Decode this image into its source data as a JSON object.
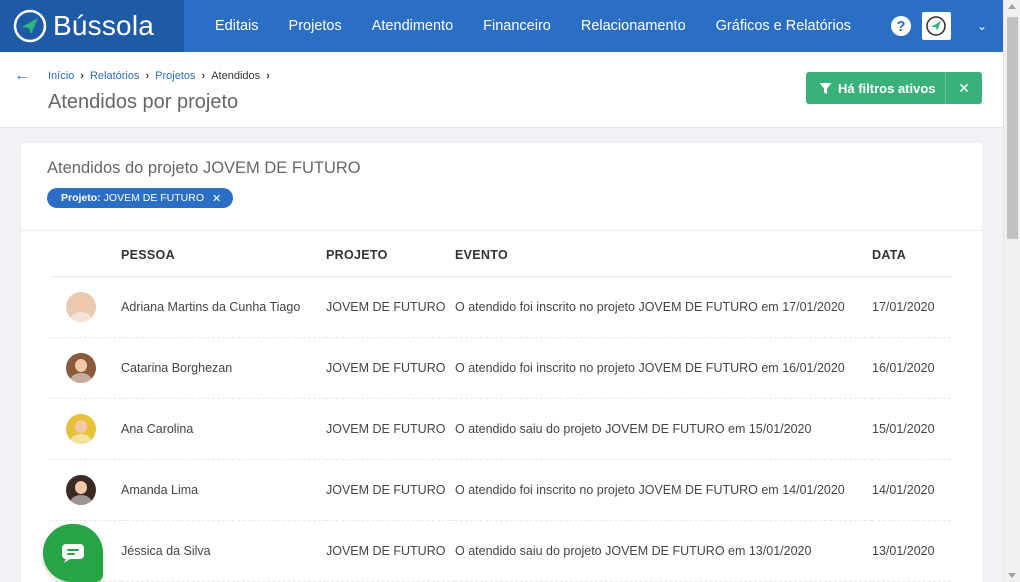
{
  "app": {
    "name": "Bússola",
    "brand_color": "#2b6fc4"
  },
  "nav": {
    "items": [
      {
        "label": "Editais"
      },
      {
        "label": "Projetos"
      },
      {
        "label": "Atendimento"
      },
      {
        "label": "Financeiro"
      },
      {
        "label": "Relacionamento"
      },
      {
        "label": "Gráficos e Relatórios"
      }
    ],
    "help_label": "?"
  },
  "breadcrumb": {
    "items": [
      {
        "label": "Início"
      },
      {
        "label": "Relatórios"
      },
      {
        "label": "Projetos"
      },
      {
        "label": "Atendidos"
      }
    ]
  },
  "page": {
    "title": "Atendidos por projeto"
  },
  "filter_button": {
    "label": "Há filtros ativos",
    "color": "#3ab17b"
  },
  "card": {
    "title": "Atendidos do projeto JOVEM DE FUTURO",
    "chip": {
      "key": "Projeto:",
      "value": "JOVEM DE FUTURO"
    }
  },
  "table": {
    "headers": {
      "pessoa": "PESSOA",
      "projeto": "PROJETO",
      "evento": "EVENTO",
      "data": "DATA"
    },
    "rows": [
      {
        "pessoa": "Adriana Martins da Cunha Tiago",
        "projeto": "JOVEM DE FUTURO",
        "evento": "O atendido foi inscrito no projeto JOVEM DE FUTURO em 17/01/2020",
        "data": "17/01/2020",
        "avatar_color": "#e9c9b0"
      },
      {
        "pessoa": "Catarina Borghezan",
        "projeto": "JOVEM DE FUTURO",
        "evento": "O atendido foi inscrito no projeto JOVEM DE FUTURO em 16/01/2020",
        "data": "16/01/2020",
        "avatar_color": "#8a5a3c"
      },
      {
        "pessoa": "Ana Carolina",
        "projeto": "JOVEM DE FUTURO",
        "evento": "O atendido saiu do projeto JOVEM DE FUTURO em 15/01/2020",
        "data": "15/01/2020",
        "avatar_color": "#e6c13a"
      },
      {
        "pessoa": "Amanda Lima",
        "projeto": "JOVEM DE FUTURO",
        "evento": "O atendido foi inscrito no projeto JOVEM DE FUTURO em 14/01/2020",
        "data": "14/01/2020",
        "avatar_color": "#3a2a22"
      },
      {
        "pessoa": "Jéssica da Silva",
        "projeto": "JOVEM DE FUTURO",
        "evento": "O atendido saiu do projeto JOVEM DE FUTURO em 13/01/2020",
        "data": "13/01/2020",
        "avatar_color": "#b08a6a"
      }
    ]
  },
  "chat": {
    "icon": "chat-icon",
    "color": "#27a546"
  }
}
